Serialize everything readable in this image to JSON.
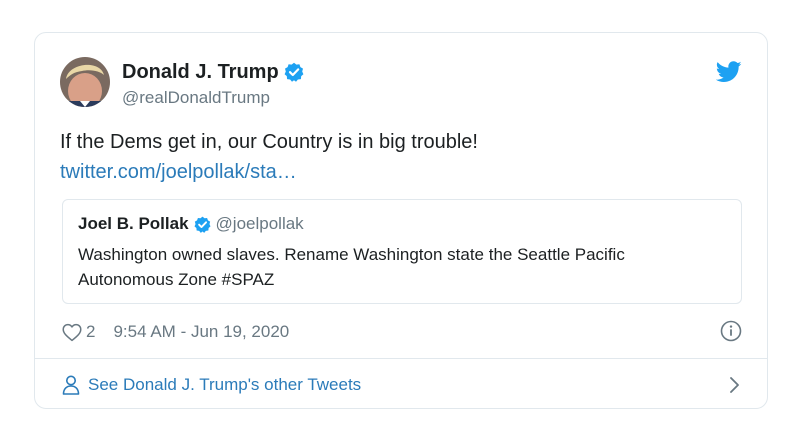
{
  "tweet": {
    "author": {
      "display_name": "Donald J. Trump",
      "handle": "@realDonaldTrump",
      "verified": true
    },
    "text": "If the Dems get in, our Country is in big trouble!",
    "link_text": "twitter.com/joelpollak/sta…",
    "quoted": {
      "display_name": "Joel B. Pollak",
      "handle": "@joelpollak",
      "verified": true,
      "text": "Washington owned slaves. Rename Washington state the Seattle Pacific Autonomous Zone #SPAZ"
    },
    "likes": "2",
    "timestamp": "9:54 AM - Jun 19, 2020"
  },
  "footer": {
    "other_tweets_label": "See Donald J. Trump's other Tweets"
  },
  "icons": {
    "verified": "verified-badge-icon",
    "bird": "twitter-bird-icon",
    "heart": "heart-icon",
    "info": "info-icon",
    "person": "person-icon",
    "chevron": "chevron-right-icon"
  },
  "colors": {
    "brand_blue": "#1da1f2",
    "link_blue": "#2b7bb9",
    "secondary_text": "#697882",
    "primary_text": "#1c2022",
    "border": "#e1e8ed"
  }
}
